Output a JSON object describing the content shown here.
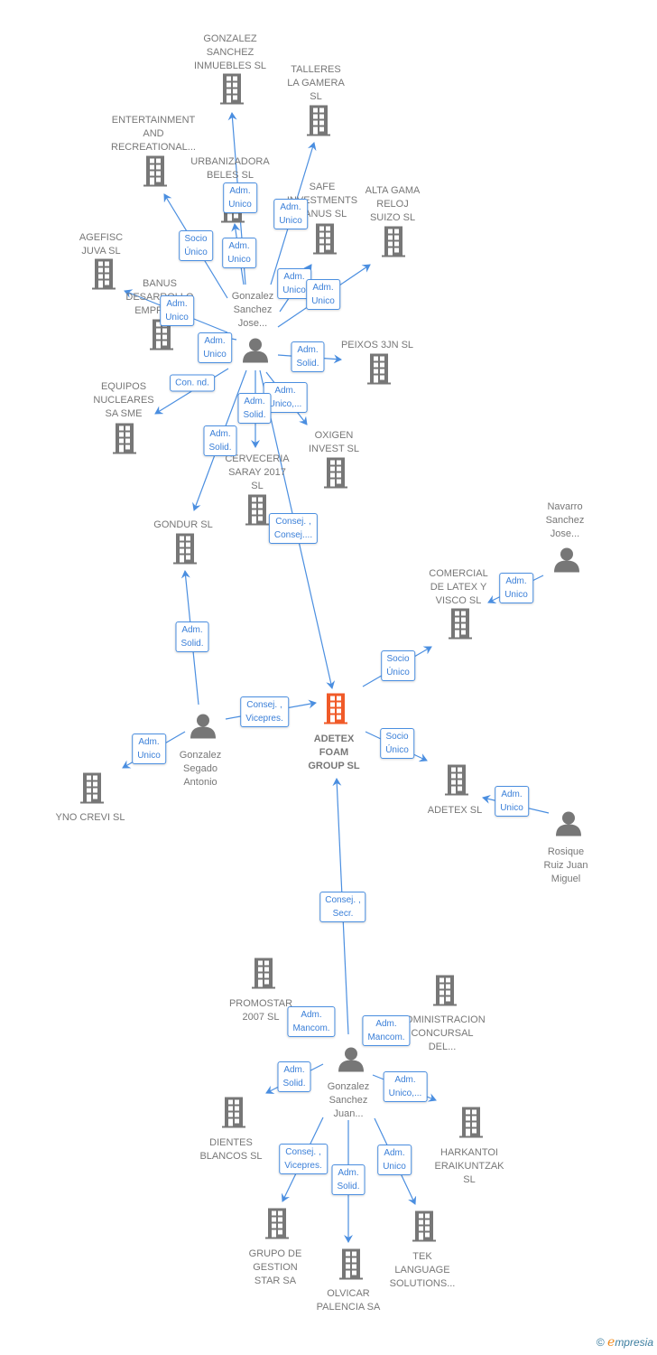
{
  "colors": {
    "edge": "#4a8ee0",
    "node": "#777777",
    "main_node": "#f05a28"
  },
  "nodes": [
    {
      "label": "GONZALEZ\nSANCHEZ\nINMUEBLES SL",
      "type": "company"
    },
    {
      "label": "TALLERES\nLA GAMERA\nSL",
      "type": "company"
    },
    {
      "label": "ENTERTAINMENT\nAND\nRECREATIONAL...",
      "type": "company"
    },
    {
      "label": "URBANIZADORA\nBELES  SL",
      "type": "company"
    },
    {
      "label": "SAFE\nINVESTMENTS\nBANUS  SL",
      "type": "company"
    },
    {
      "label": "ALTA GAMA\nRELOJ\nSUIZO SL",
      "type": "company"
    },
    {
      "label": "AGEFISC\nJUVA SL",
      "type": "company"
    },
    {
      "label": "BANUS\nDESARROLLO\nEMPRES...",
      "type": "company"
    },
    {
      "label": "PEIXOS 3JN SL",
      "type": "company"
    },
    {
      "label": "EQUIPOS\nNUCLEARES\nSA SME",
      "type": "company"
    },
    {
      "label": "OXIGEN\nINVEST  SL",
      "type": "company"
    },
    {
      "label": "CERVECERIA\nSARAY 2017\nSL",
      "type": "company"
    },
    {
      "label": "GONDUR SL",
      "type": "company"
    },
    {
      "label": "COMERCIAL\nDE LATEX Y\nVISCO  SL",
      "type": "company"
    },
    {
      "label": "ADETEX\nFOAM\nGROUP  SL",
      "type": "main"
    },
    {
      "label": "YNO CREVI SL",
      "type": "company"
    },
    {
      "label": "ADETEX SL",
      "type": "company"
    },
    {
      "label": "PROMOSTAR\n2007 SL",
      "type": "company"
    },
    {
      "label": "ADMINISTRACION\nCONCURSAL\nDEL...",
      "type": "company"
    },
    {
      "label": "DIENTES\nBLANCOS  SL",
      "type": "company"
    },
    {
      "label": "HARKANTOI\nERAIKUNTZAK\nSL",
      "type": "company"
    },
    {
      "label": "GRUPO DE\nGESTION\nSTAR SA",
      "type": "company"
    },
    {
      "label": "OLVICAR\nPALENCIA SA",
      "type": "company"
    },
    {
      "label": "TEK\nLANGUAGE\nSOLUTIONS...",
      "type": "company"
    },
    {
      "label": "Gonzalez\nSanchez\nJose...",
      "type": "person"
    },
    {
      "label": "Navarro\nSanchez\nJose...",
      "type": "person"
    },
    {
      "label": "Gonzalez\nSegado\nAntonio",
      "type": "person"
    },
    {
      "label": "Rosique\nRuiz Juan\nMiguel",
      "type": "person"
    },
    {
      "label": "Gonzalez\nSanchez\nJuan...",
      "type": "person"
    }
  ],
  "edges": [
    {
      "from": 24,
      "to": 0,
      "label": "Adm.\nUnico"
    },
    {
      "from": 24,
      "to": 3,
      "label": "Adm.\nUnico"
    },
    {
      "from": 24,
      "to": 1,
      "label": "Adm.\nUnico"
    },
    {
      "from": 24,
      "to": 2,
      "label": "Socio\nÚnico"
    },
    {
      "from": 24,
      "to": 4,
      "label": "Adm.\nUnico"
    },
    {
      "from": 24,
      "to": 5,
      "label": "Adm.\nUnico"
    },
    {
      "from": 24,
      "to": 6,
      "label": "Adm.\nUnico"
    },
    {
      "from": 24,
      "to": 7,
      "label": "Adm.\nUnico"
    },
    {
      "from": 24,
      "to": 8,
      "label": "Adm.\nSolid."
    },
    {
      "from": 24,
      "to": 9,
      "label": "Con.  nd."
    },
    {
      "from": 24,
      "to": 10,
      "label": "Adm.\nUnico,..."
    },
    {
      "from": 24,
      "to": 11,
      "label": "Adm.\nSolid."
    },
    {
      "from": 24,
      "to": 12,
      "label": "Adm.\nSolid."
    },
    {
      "from": 24,
      "to": 14,
      "label": "Consej. ,\nConsej...."
    },
    {
      "from": 25,
      "to": 13,
      "label": "Adm.\nUnico"
    },
    {
      "from": 26,
      "to": 12,
      "label": "Adm.\nSolid."
    },
    {
      "from": 26,
      "to": 14,
      "label": "Consej. ,\nVicepres."
    },
    {
      "from": 26,
      "to": 15,
      "label": "Adm.\nUnico"
    },
    {
      "from": 14,
      "to": 13,
      "label": "Socio\nÚnico"
    },
    {
      "from": 14,
      "to": 16,
      "label": "Socio\nÚnico"
    },
    {
      "from": 27,
      "to": 16,
      "label": "Adm.\nUnico"
    },
    {
      "from": 28,
      "to": 14,
      "label": "Consej. ,\nSecr."
    },
    {
      "from": 28,
      "to": 17,
      "label": "Adm.\nMancom."
    },
    {
      "from": 28,
      "to": 18,
      "label": "Adm.\nMancom."
    },
    {
      "from": 28,
      "to": 19,
      "label": "Adm.\nSolid."
    },
    {
      "from": 28,
      "to": 20,
      "label": "Adm.\nUnico,..."
    },
    {
      "from": 28,
      "to": 21,
      "label": "Consej. ,\nVicepres."
    },
    {
      "from": 28,
      "to": 22,
      "label": "Adm.\nSolid."
    },
    {
      "from": 28,
      "to": 23,
      "label": "Adm.\nUnico"
    }
  ],
  "footer": {
    "copyright": "©",
    "brand_e": "e",
    "brand_rest": "mpresia"
  }
}
